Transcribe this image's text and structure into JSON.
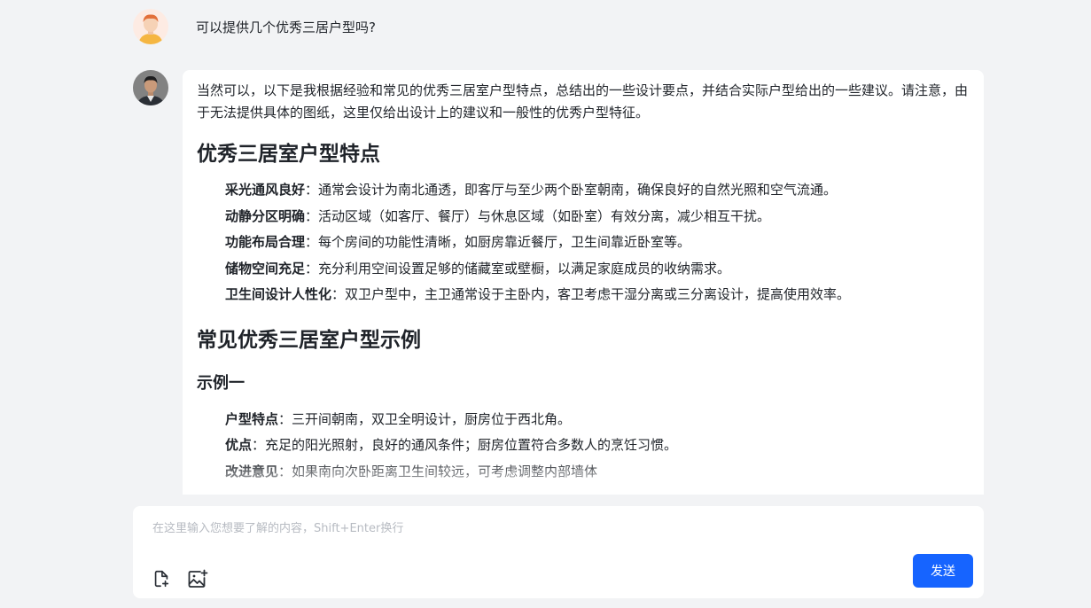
{
  "user_message": {
    "text": "可以提供几个优秀三居户型吗?"
  },
  "answer": {
    "intro": "当然可以，以下是我根据经验和常见的优秀三居室户型特点，总结出的一些设计要点，并结合实际户型给出的一些建议。请注意，由于无法提供具体的图纸，这里仅给出设计上的建议和一般性的优秀户型特征。",
    "section1": {
      "title": "优秀三居室户型特点",
      "items": [
        {
          "term": "采光通风良好",
          "desc": "：通常会设计为南北通透，即客厅与至少两个卧室朝南，确保良好的自然光照和空气流通。"
        },
        {
          "term": "动静分区明确",
          "desc": "：活动区域（如客厅、餐厅）与休息区域（如卧室）有效分离，减少相互干扰。"
        },
        {
          "term": "功能布局合理",
          "desc": "：每个房间的功能性清晰，如厨房靠近餐厅，卫生间靠近卧室等。"
        },
        {
          "term": "储物空间充足",
          "desc": "：充分利用空间设置足够的储藏室或壁橱，以满足家庭成员的收纳需求。"
        },
        {
          "term": "卫生间设计人性化",
          "desc": "：双卫户型中，主卫通常设于主卧内，客卫考虑干湿分离或三分离设计，提高使用效率。"
        }
      ]
    },
    "section2": {
      "title": "常见优秀三居室户型示例",
      "example1": {
        "title": "示例一",
        "items": [
          {
            "term": "户型特点",
            "desc": "：三开间朝南，双卫全明设计，厨房位于西北角。"
          },
          {
            "term": "优点",
            "desc": "：充足的阳光照射，良好的通风条件；厨房位置符合多数人的烹饪习惯。"
          },
          {
            "term": "改进意见",
            "desc": "：如果南向次卧距离卫生间较远，可考虑调整内部墙体"
          }
        ]
      }
    }
  },
  "input": {
    "placeholder": "在这里输入您想要了解的内容，Shift+Enter换行",
    "value": "",
    "send_label": "发送"
  },
  "icons": {
    "file": "file-plus-icon",
    "image": "image-plus-icon"
  },
  "colors": {
    "accent": "#1664ff",
    "background": "#f2f3f5"
  }
}
